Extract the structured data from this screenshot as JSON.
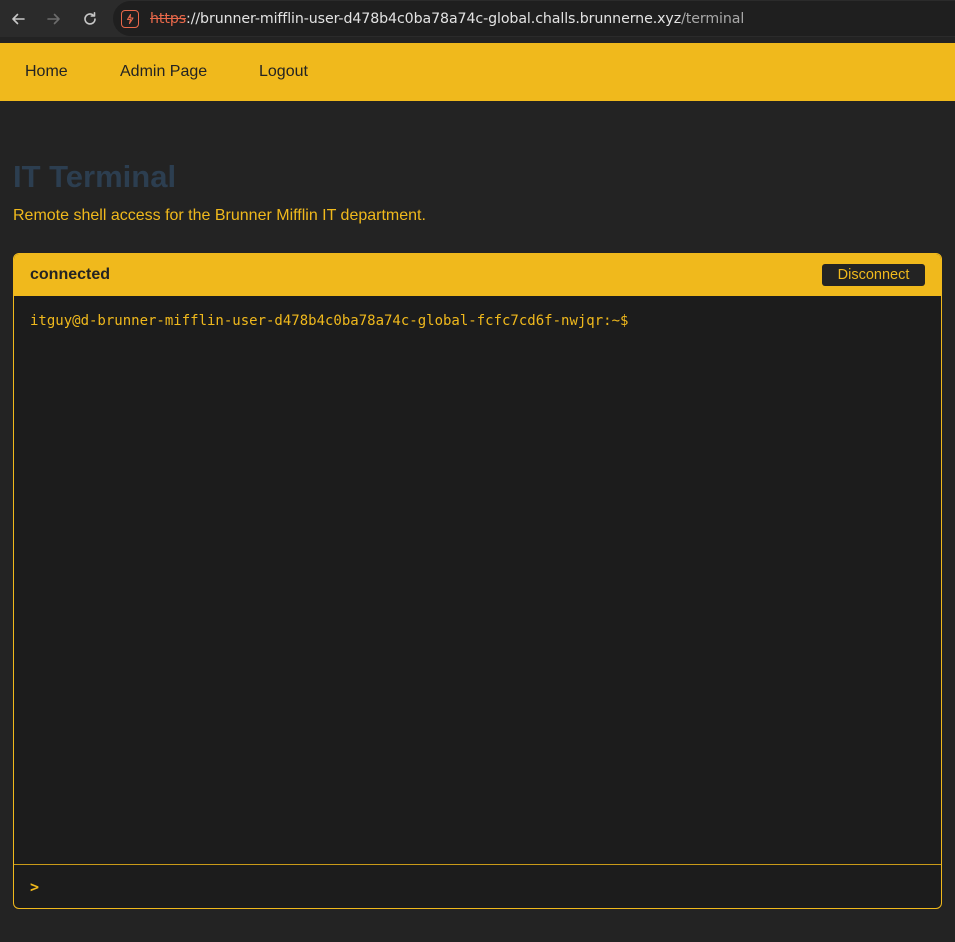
{
  "browser": {
    "url_scheme": "https",
    "url_host": "://brunner-mifflin-user-d478b4c0ba78a74c-global.challs.brunnerne.xyz",
    "url_path": "/terminal",
    "icons": {
      "back": "arrow-left-icon",
      "forward": "arrow-right-icon",
      "reload": "reload-icon",
      "site": "insecure-site-icon"
    }
  },
  "nav": {
    "home": "Home",
    "admin": "Admin Page",
    "logout": "Logout"
  },
  "page": {
    "title": "IT Terminal",
    "subtitle": "Remote shell access for the Brunner Mifflin IT department."
  },
  "terminal": {
    "status": "connected",
    "disconnect_label": "Disconnect",
    "output": "itguy@d-brunner-mifflin-user-d478b4c0ba78a74c-global-fcfc7cd6f-nwjqr:~$",
    "prompt": ">",
    "input_value": ""
  },
  "colors": {
    "accent": "#f0b91c",
    "background": "#232323",
    "title": "#2c3e50",
    "insecure": "#e8684a"
  }
}
